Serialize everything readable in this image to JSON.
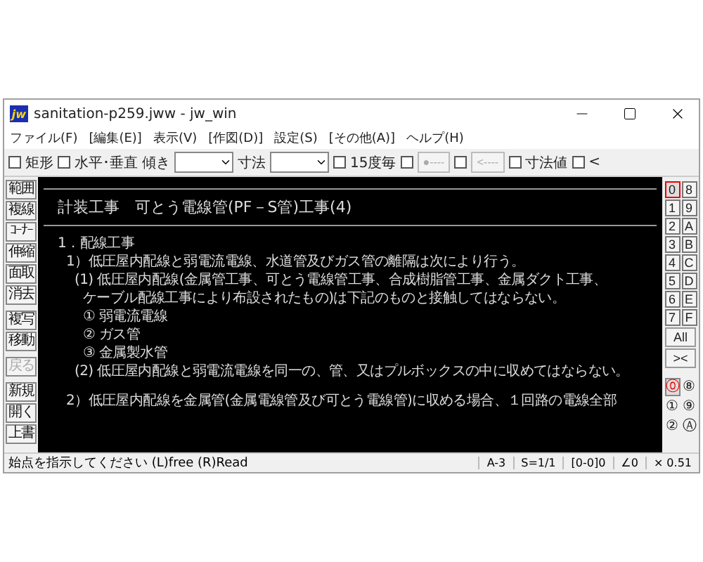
{
  "window": {
    "icon_text": "jw",
    "title": "sanitation-p259.jww - jw_win"
  },
  "menu": [
    {
      "label": "ファイル(F)"
    },
    {
      "label": "[編集(E)]"
    },
    {
      "label": "表示(V)"
    },
    {
      "label": "[作図(D)]"
    },
    {
      "label": "設定(S)"
    },
    {
      "label": "[その他(A)]"
    },
    {
      "label": "ヘルプ(H)"
    }
  ],
  "toolbar": [
    {
      "kind": "checkbox",
      "label": "矩形",
      "checked": false
    },
    {
      "kind": "checkbox",
      "label": "水平･垂直",
      "checked": false
    },
    {
      "kind": "combo",
      "label": "傾き"
    },
    {
      "kind": "combo",
      "label": "寸法"
    },
    {
      "kind": "checkbox",
      "label": "15度毎",
      "checked": false
    },
    {
      "kind": "checkbutton",
      "button": "●----",
      "checked": false,
      "disabled": true
    },
    {
      "kind": "checkbutton",
      "button": "<----",
      "checked": false,
      "disabled": true
    },
    {
      "kind": "checkbox",
      "label": "寸法値",
      "checked": false
    },
    {
      "kind": "checkbox",
      "label": "<",
      "checked": false
    }
  ],
  "left_tools": [
    [
      {
        "label": "範囲",
        "disabled": false
      },
      {
        "label": "複線",
        "disabled": false
      },
      {
        "label": "ｺｰﾅｰ",
        "disabled": false
      },
      {
        "label": "伸縮",
        "disabled": false
      },
      {
        "label": "面取",
        "disabled": false
      },
      {
        "label": "消去",
        "disabled": false
      }
    ],
    [
      {
        "label": "複写",
        "disabled": false
      },
      {
        "label": "移動",
        "disabled": false
      }
    ],
    [
      {
        "label": "戻る",
        "disabled": true
      }
    ],
    [
      {
        "label": "新規",
        "disabled": false
      },
      {
        "label": "開く",
        "disabled": false
      },
      {
        "label": "上書",
        "disabled": false
      }
    ]
  ],
  "drawing": {
    "title": "計装工事　可とう電線管(PF－S管)工事(4)",
    "lines": [
      {
        "text": "1．配線工事",
        "children": [
          {
            "text": "1）低圧屋内配線と弱電流電線、水道管及びガス管の離隔は次により行う。",
            "children": [
              {
                "text": "(1) 低圧屋内配線(金属管工事、可とう電線管工事、合成樹脂管工事、金属ダクト工事、",
                "children": [
                  {
                    "text": "ケーブル配線工事により布設されたもの)は下記のものと接触してはならない。"
                  },
                  {
                    "text": "① 弱電流電線"
                  },
                  {
                    "text": "② ガス管"
                  },
                  {
                    "text": "③ 金属製水管"
                  }
                ]
              },
              {
                "text": "(2) 低圧屋内配線と弱電流電線を同一の、管、又はプルボックスの中に収めてはならない。"
              }
            ]
          },
          {
            "text": "2）低圧屋内配線を金属管(金属電線管及び可とう電線管)に収める場合、１回路の電線全部"
          }
        ]
      }
    ]
  },
  "layer_groups": [
    {
      "label": "0",
      "selected": true
    },
    {
      "label": "8",
      "selected": false
    },
    {
      "label": "1",
      "selected": false
    },
    {
      "label": "9",
      "selected": false
    },
    {
      "label": "2",
      "selected": false
    },
    {
      "label": "A",
      "selected": false
    },
    {
      "label": "3",
      "selected": false
    },
    {
      "label": "B",
      "selected": false
    },
    {
      "label": "4",
      "selected": false
    },
    {
      "label": "C",
      "selected": false
    },
    {
      "label": "5",
      "selected": false
    },
    {
      "label": "D",
      "selected": false
    },
    {
      "label": "6",
      "selected": false
    },
    {
      "label": "E",
      "selected": false
    },
    {
      "label": "7",
      "selected": false
    },
    {
      "label": "F",
      "selected": false
    }
  ],
  "all_label": "All",
  "swap_label": "><",
  "layers": [
    {
      "label": "⓪",
      "selected": true
    },
    {
      "label": "⑧",
      "selected": false
    },
    {
      "label": "①",
      "selected": false
    },
    {
      "label": "⑨",
      "selected": false
    },
    {
      "label": "②",
      "selected": false
    },
    {
      "label": "Ⓐ",
      "selected": false
    }
  ],
  "status": {
    "message": "始点を指示してください (L)free (R)Read",
    "cells": [
      "A-3",
      "S=1/1",
      "[0-0]0",
      "∠0",
      "× 0.51"
    ]
  }
}
